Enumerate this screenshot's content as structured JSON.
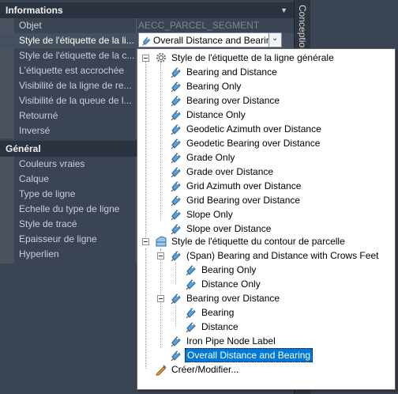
{
  "palette": {
    "side_tab": "Conception",
    "sections": {
      "informations": "Informations",
      "general": "Général"
    },
    "info_rows": [
      {
        "label": "Objet",
        "value": "AECC_PARCEL_SEGMENT"
      },
      {
        "label": "Style de l'étiquette de la li..."
      },
      {
        "label": "Style de l'étiquette de la c..."
      },
      {
        "label": "L'étiquette est accrochée"
      },
      {
        "label": "Visibilité de la ligne de re..."
      },
      {
        "label": "Visibilité de la queue de l..."
      },
      {
        "label": "Retourné"
      },
      {
        "label": "Inversé"
      }
    ],
    "general_rows": [
      {
        "label": "Couleurs vraies"
      },
      {
        "label": "Calque"
      },
      {
        "label": "Type de ligne"
      },
      {
        "label": "Echelle du type de ligne"
      },
      {
        "label": "Style de tracé"
      },
      {
        "label": "Epaisseur de ligne"
      },
      {
        "label": "Hyperlien"
      }
    ]
  },
  "combo": {
    "value": "Overall Distance and Bearing",
    "arrow": "⌄"
  },
  "dropdown": {
    "group1": {
      "label": "Style de l'étiquette de la ligne générale",
      "items": [
        "Bearing and Distance",
        "Bearing Only",
        "Bearing over Distance",
        "Distance Only",
        "Geodetic Azimuth over Distance",
        "Geodetic Bearing over Distance",
        "Grade Only",
        "Grade over Distance",
        "Grid Azimuth over Distance",
        "Grid Bearing over Distance",
        "Slope Only",
        "Slope over Distance"
      ]
    },
    "group2": {
      "label": "Style de l'étiquette du contour de parcelle",
      "sub1": {
        "label": "(Span)  Bearing and Distance with Crows Feet",
        "items": [
          "Bearing Only",
          "Distance Only"
        ]
      },
      "sub2": {
        "label": "Bearing over Distance",
        "items": [
          "Bearing",
          "Distance"
        ]
      },
      "items": [
        "Iron Pipe Node Label",
        "Overall Distance and Bearing"
      ]
    },
    "create_modify": "Créer/Modifier..."
  },
  "colors": {
    "panel_bg": "#3b4453",
    "header_bg": "#2c3340",
    "selection": "#0078d7"
  }
}
